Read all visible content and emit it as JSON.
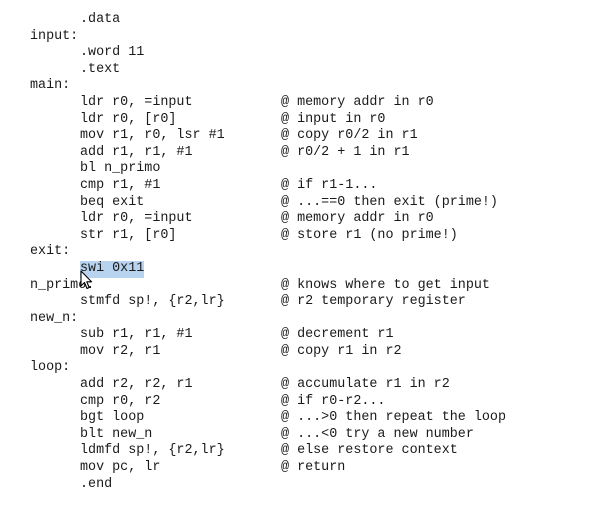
{
  "editor": {
    "lines": [
      {
        "label": "",
        "instr": ".data",
        "comment": ""
      },
      {
        "label": "input:",
        "instr": "",
        "comment": ""
      },
      {
        "label": "",
        "instr": ".word 11",
        "comment": ""
      },
      {
        "label": "",
        "instr": ".text",
        "comment": ""
      },
      {
        "label": "main:",
        "instr": "",
        "comment": ""
      },
      {
        "label": "",
        "instr": "ldr r0, =input",
        "comment": "@ memory addr in r0"
      },
      {
        "label": "",
        "instr": "ldr r0, [r0]",
        "comment": "@ input in r0"
      },
      {
        "label": "",
        "instr": "mov r1, r0, lsr #1",
        "comment": "@ copy r0/2 in r1"
      },
      {
        "label": "",
        "instr": "add r1, r1, #1",
        "comment": "@ r0/2 + 1 in r1"
      },
      {
        "label": "",
        "instr": "bl n_primo",
        "comment": ""
      },
      {
        "label": "",
        "instr": "cmp r1, #1",
        "comment": "@ if r1-1..."
      },
      {
        "label": "",
        "instr": "beq exit",
        "comment": "@ ...==0 then exit (prime!)"
      },
      {
        "label": "",
        "instr": "ldr r0, =input",
        "comment": "@ memory addr in r0"
      },
      {
        "label": "",
        "instr": "str r1, [r0]",
        "comment": "@ store r1 (no prime!)"
      },
      {
        "label": "exit:",
        "instr": "",
        "comment": ""
      },
      {
        "label": "",
        "instr": "swi 0x11",
        "comment": "",
        "selected": true
      },
      {
        "label": "n_primo:",
        "instr": "",
        "comment": "@ knows where to get input"
      },
      {
        "label": "",
        "instr": "stmfd sp!, {r2,lr}",
        "comment": "@ r2 temporary register"
      },
      {
        "label": "new_n:",
        "instr": "",
        "comment": ""
      },
      {
        "label": "",
        "instr": "sub r1, r1, #1",
        "comment": "@ decrement r1"
      },
      {
        "label": "",
        "instr": "mov r2, r1",
        "comment": "@ copy r1 in r2"
      },
      {
        "label": "loop:",
        "instr": "",
        "comment": ""
      },
      {
        "label": "",
        "instr": "add r2, r2, r1",
        "comment": "@ accumulate r1 in r2"
      },
      {
        "label": "",
        "instr": "cmp r0, r2",
        "comment": "@ if r0-r2..."
      },
      {
        "label": "",
        "instr": "bgt loop",
        "comment": "@ ...>0 then repeat the loop"
      },
      {
        "label": "",
        "instr": "blt new_n",
        "comment": "@ ...<0 try a new number"
      },
      {
        "label": "",
        "instr": "ldmfd sp!, {r2,lr}",
        "comment": "@ else restore context"
      },
      {
        "label": "",
        "instr": "mov pc, lr",
        "comment": "@ return"
      },
      {
        "label": "",
        "instr": ".end",
        "comment": ""
      }
    ]
  },
  "colors": {
    "text": "#1a1a1a",
    "selection": "#b7d3ef",
    "background": "#ffffff"
  },
  "icons": {
    "cursor": "mouse-pointer-icon"
  }
}
